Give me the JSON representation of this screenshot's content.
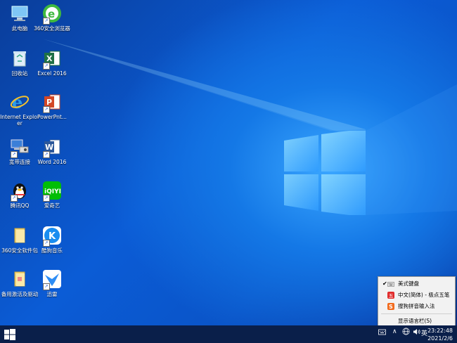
{
  "desktop": {
    "icons": [
      {
        "label": "此电脑"
      },
      {
        "label": "360安全浏览器"
      },
      {
        "label": "回收站"
      },
      {
        "label": "Excel 2016"
      },
      {
        "label": "Internet Explorer"
      },
      {
        "label": "PowerPnt..."
      },
      {
        "label": "宽带连接"
      },
      {
        "label": "Word 2016"
      },
      {
        "label": "腾讯QQ"
      },
      {
        "label": "爱奇艺"
      },
      {
        "label": "360安全软件包"
      },
      {
        "label": "酷狗音乐"
      },
      {
        "label": "备用激活及驱动"
      },
      {
        "label": "迅雷"
      }
    ]
  },
  "input_menu": {
    "items": [
      "美式键盘",
      "中文(简体) - 极点五笔",
      "搜狗拼音输入法"
    ],
    "show_langbar": "显示语言栏(S)"
  },
  "taskbar": {
    "ime_indicator": "英",
    "clock_time": "23:22:48",
    "clock_date": "2021/2/6"
  },
  "colors": {
    "accent": "#0b5cd6",
    "taskbar": "#0a1f4a"
  }
}
